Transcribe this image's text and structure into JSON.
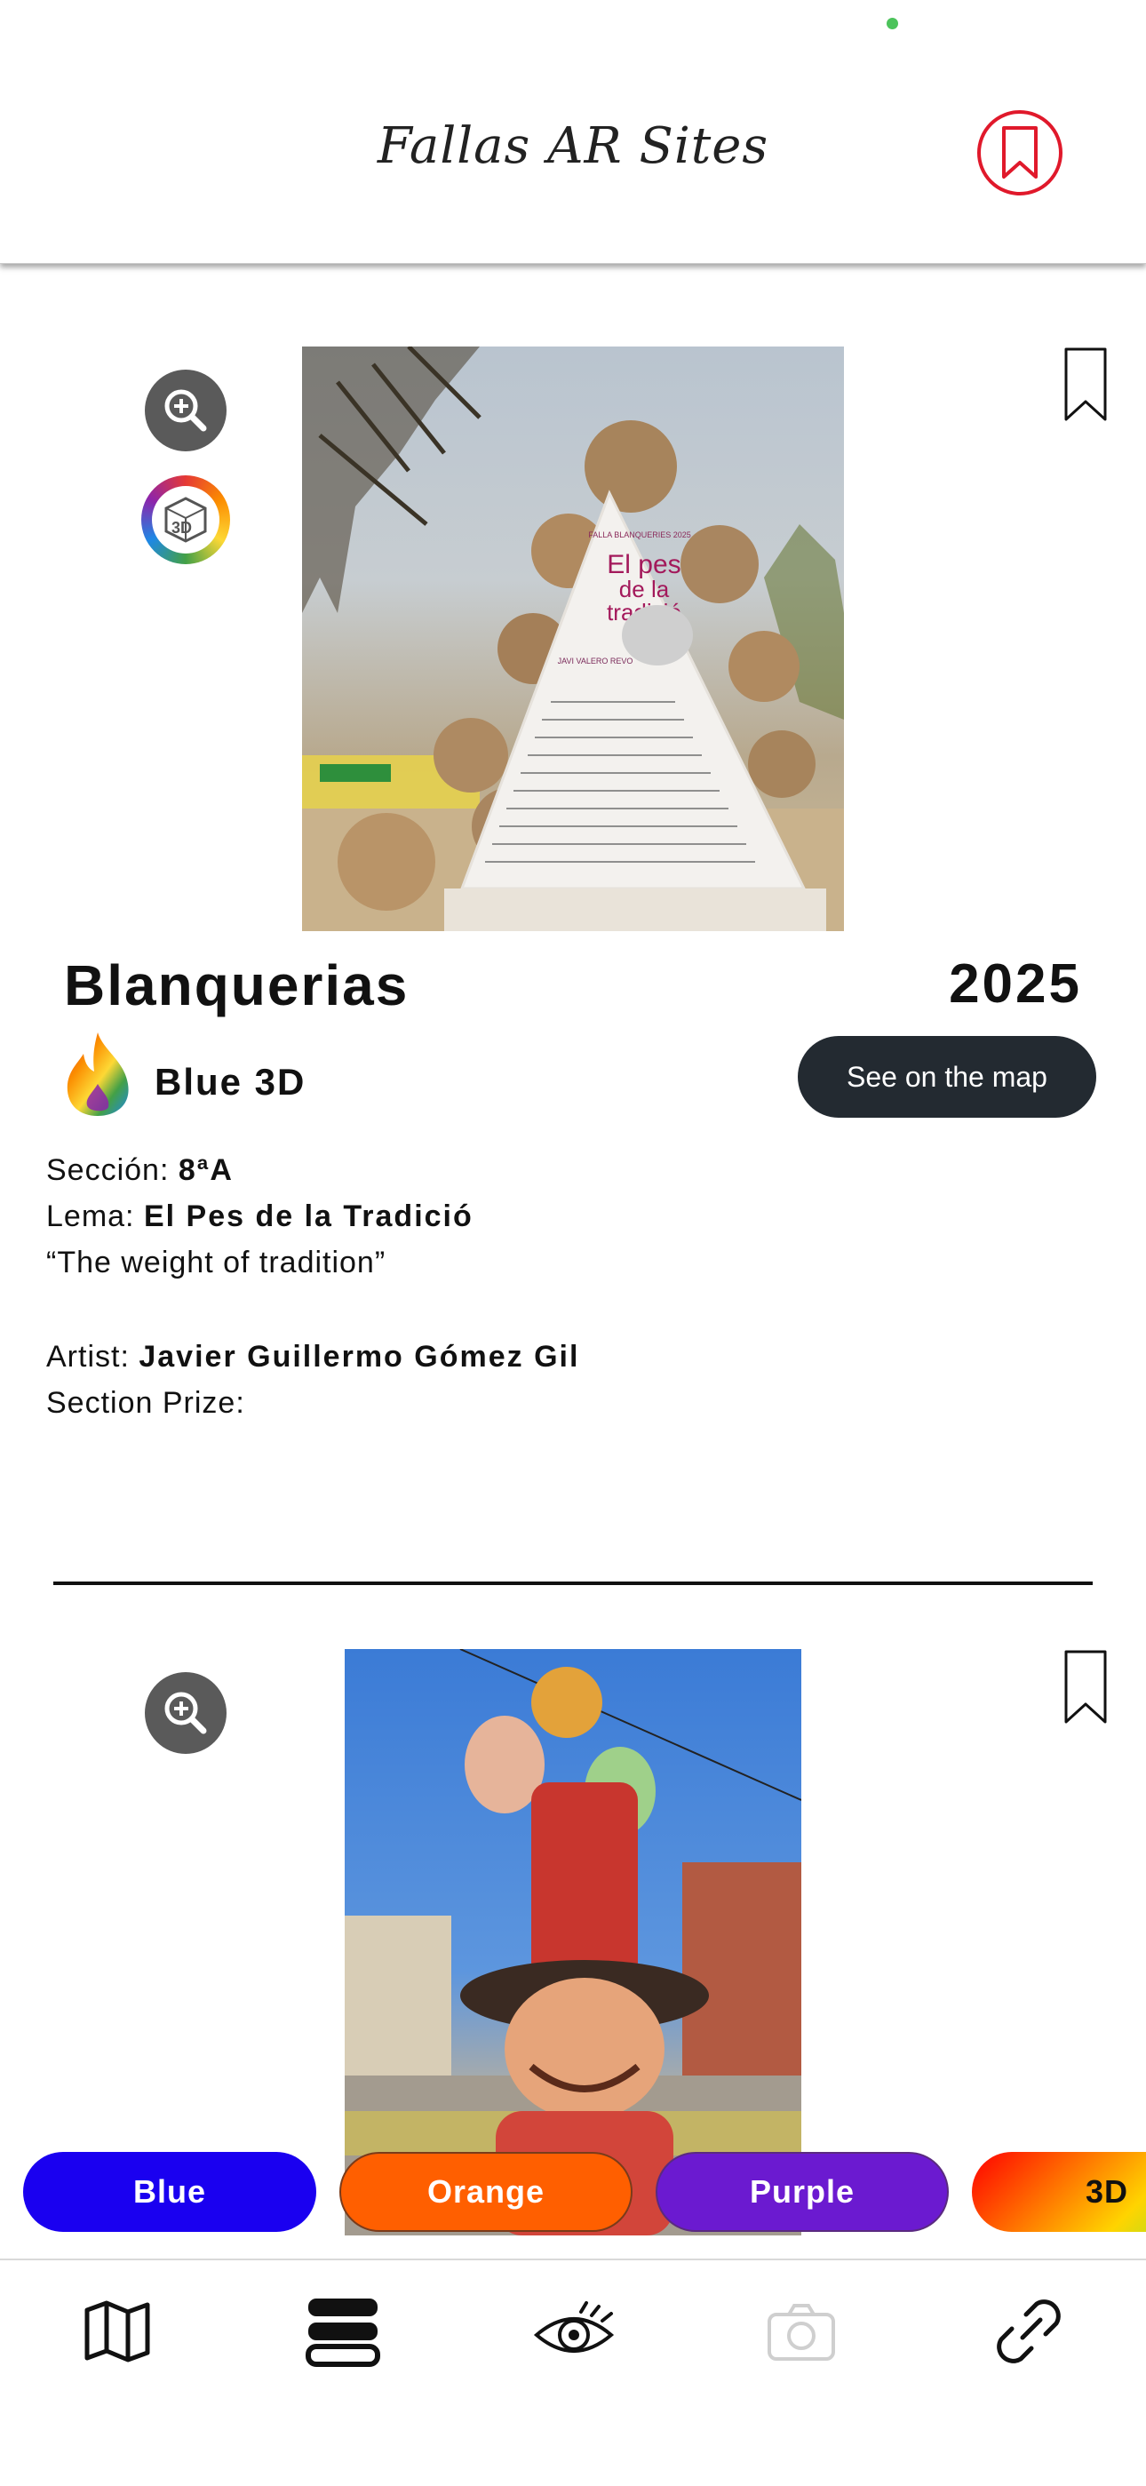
{
  "header": {
    "title": "Fallas AR Sites",
    "bookmark_icon": "bookmark-icon",
    "accent": "#e0192b"
  },
  "cards": [
    {
      "name": "Blanquerias",
      "year": "2025",
      "category": "Blue 3D",
      "map_button": "See on the map",
      "seccion_label": "Sección:",
      "seccion_value": "8ªA",
      "lema_label": "Lema:",
      "lema_value": "El Pes de la Tradició",
      "translation": "“The weight of tradition”",
      "artist_label": "Artist:",
      "artist_value": "Javier Guillermo Gómez Gil",
      "prize_label": "Section Prize:",
      "sign": {
        "falla": "FALLA BLANQUERIES 2025",
        "title_line1": "El pes",
        "title_line2": "de la",
        "title_line3": "tradició",
        "artist": "JAVI VALERO REVO"
      }
    }
  ],
  "filters": [
    {
      "label": "Blue",
      "color": "#1a00f0"
    },
    {
      "label": "Orange",
      "color": "#ff5f00"
    },
    {
      "label": "Purple",
      "color": "#6b1ad0"
    },
    {
      "label": "3D"
    }
  ],
  "nav": [
    "map-icon",
    "list-icon",
    "eye-icon",
    "camera-icon",
    "link-icon"
  ]
}
